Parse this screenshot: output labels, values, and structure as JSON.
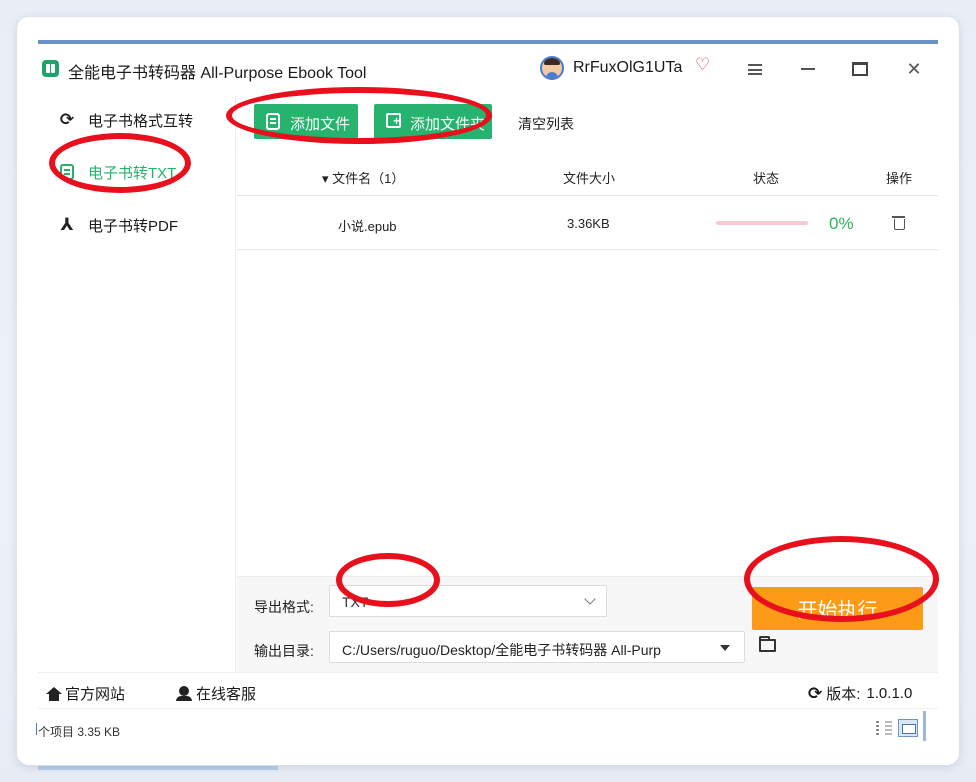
{
  "window": {
    "title": "全能电子书转码器 All-Purpose Ebook Tool",
    "username": "RrFuxOlG1UTa"
  },
  "sidebar": {
    "items": [
      {
        "label": "电子书格式互转",
        "active": false,
        "icon": "refresh-icon"
      },
      {
        "label": "电子书转TXT",
        "active": true,
        "icon": "document-icon"
      },
      {
        "label": "电子书转PDF",
        "active": false,
        "icon": "pdf-icon"
      }
    ]
  },
  "toolbar": {
    "add_file_label": "添加文件",
    "add_folder_label": "添加文件夹",
    "clear_list_label": "清空列表"
  },
  "table": {
    "headers": {
      "name": "▾ 文件名（1）",
      "size": "文件大小",
      "status": "状态",
      "action": "操作"
    },
    "rows": [
      {
        "name": "小说.epub",
        "size": "3.36KB",
        "progress": 0,
        "percent": "0%"
      }
    ]
  },
  "settings": {
    "format_label": "导出格式:",
    "format_value": "TXT",
    "output_label": "输出目录:",
    "output_value": "C:/Users/ruguo/Desktop/全能电子书转码器 All-Purp",
    "start_label": "开始执行"
  },
  "footer": {
    "website_label": "官方网站",
    "service_label": "在线客服",
    "version_label": "版本:",
    "version_value": "1.0.1.0"
  },
  "statusbar": {
    "text": "个项目  3.35 KB"
  },
  "colors": {
    "accent_green": "#25b36d",
    "start_orange": "#fd9a16",
    "annotation_red": "#e8101c",
    "progress_pink": "#f6c9d3"
  }
}
